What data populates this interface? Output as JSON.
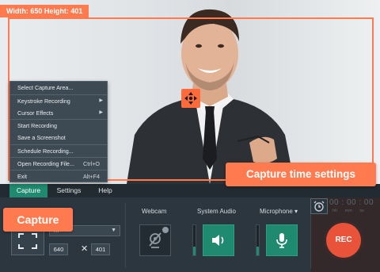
{
  "capture_area": {
    "size_label": "Width: 650  Height: 401"
  },
  "context_menu": {
    "items": [
      {
        "label": "Select Capture Area...",
        "submenu": false,
        "shortcut": ""
      },
      {
        "label": "Keystroke Recording",
        "submenu": true,
        "shortcut": ""
      },
      {
        "label": "Cursor Effects",
        "submenu": true,
        "shortcut": ""
      },
      {
        "label": "Start Recording",
        "submenu": false,
        "shortcut": ""
      },
      {
        "label": "Save a Screenshot",
        "submenu": false,
        "shortcut": ""
      },
      {
        "label": "Schedule Recording...",
        "submenu": false,
        "shortcut": ""
      },
      {
        "label": "Open Recording File...",
        "submenu": false,
        "shortcut": "Ctrl+O"
      },
      {
        "label": "Exit",
        "submenu": false,
        "shortcut": "Alt+F4"
      }
    ]
  },
  "tabs": [
    {
      "label": "Capture",
      "active": true
    },
    {
      "label": "Settings",
      "active": false
    },
    {
      "label": "Help",
      "active": false
    }
  ],
  "callouts": {
    "capture": "Capture",
    "time_settings": "Capture time settings"
  },
  "capture_section": {
    "preset_value": "m",
    "width_value": "640",
    "height_value": "401",
    "times_glyph": "✕"
  },
  "webcam": {
    "label": "Webcam",
    "state": "off"
  },
  "system_audio": {
    "label": "System Audio",
    "state": "on",
    "level_fraction": 0.28
  },
  "microphone": {
    "label": "Microphone ▾",
    "state": "on",
    "level_fraction": 0.28
  },
  "timer": {
    "display": "00 : 00 : 00",
    "units": "hh mm ss"
  },
  "rec_button": {
    "label": "REC"
  },
  "colors": {
    "accent_orange": "#ff7a4f",
    "active_green": "#1f8a6f",
    "rec_red": "#e8533a",
    "panel_bg": "#2c363e"
  }
}
